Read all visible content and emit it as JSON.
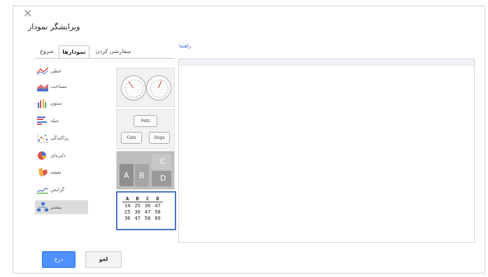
{
  "dialog": {
    "close_label": "×",
    "title": "ویرایشگر نمودار",
    "tabs": [
      {
        "label": "شروع"
      },
      {
        "label": "نمودارها"
      },
      {
        "label": "سفارشی کردن"
      }
    ],
    "active_tab": "نمودارها",
    "help_link": "راهنما"
  },
  "chart_types": [
    {
      "label": "خطی",
      "icon": "line-chart-icon"
    },
    {
      "label": "مساحت",
      "icon": "area-chart-icon"
    },
    {
      "label": "ستون",
      "icon": "column-chart-icon"
    },
    {
      "label": "میله",
      "icon": "bar-chart-icon"
    },
    {
      "label": "پراکندگی",
      "icon": "scatter-chart-icon"
    },
    {
      "label": "دایره‌ای",
      "icon": "pie-chart-icon"
    },
    {
      "label": "نقشه",
      "icon": "map-chart-icon"
    },
    {
      "label": "گرایش",
      "icon": "trend-chart-icon"
    },
    {
      "label": "بیشتر",
      "icon": "more-charts-icon",
      "selected": true
    }
  ],
  "thumbnails": {
    "org_chart": {
      "root": "Pets",
      "children": [
        "Cats",
        "Dogs"
      ]
    },
    "treemap": {
      "labels": [
        "A",
        "B",
        "C",
        "D"
      ]
    },
    "table": {
      "header": [
        "A",
        "B",
        "C",
        "D"
      ],
      "rows": [
        [
          "14",
          "25",
          "36",
          "47"
        ],
        [
          "25",
          "36",
          "47",
          "58"
        ],
        [
          "36",
          "47",
          "58",
          "69"
        ]
      ]
    }
  },
  "buttons": {
    "ok": "درج",
    "cancel": "لغو"
  },
  "colors": {
    "accent_blue": "#4d90fe",
    "selected_border": "#4a74c9",
    "selected_item_bg": "#dcdcdc"
  }
}
